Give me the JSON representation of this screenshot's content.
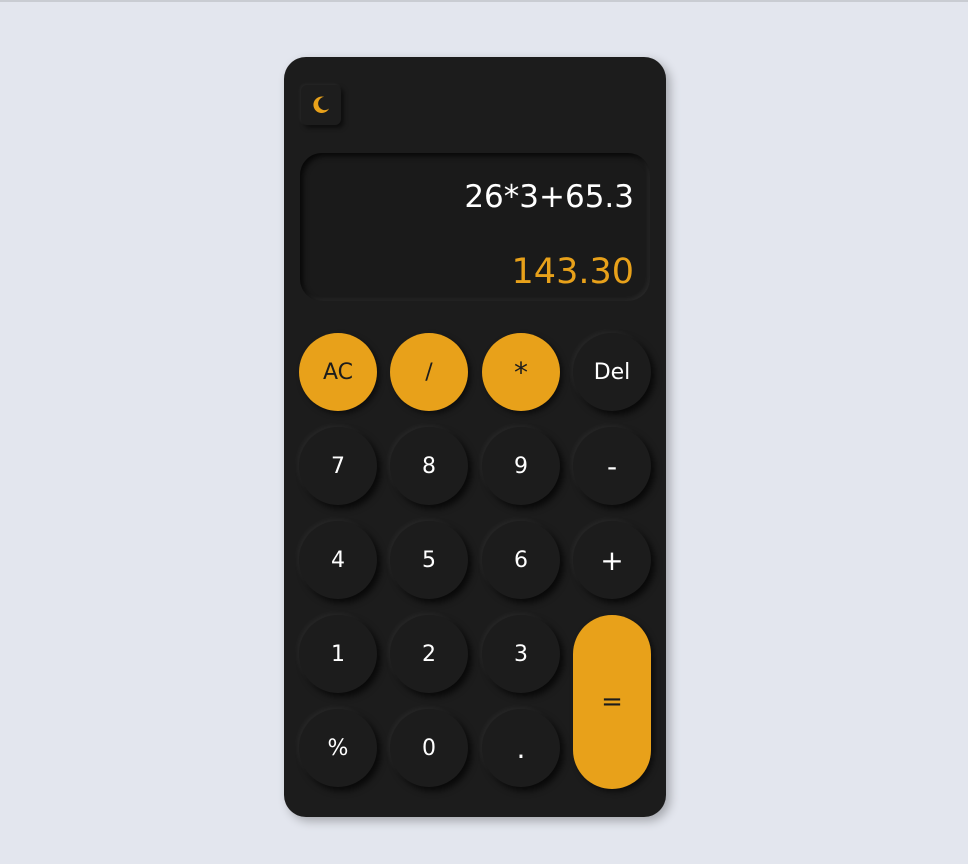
{
  "theme_toggle": {
    "icon": "moon-icon",
    "color": "#e8a11a"
  },
  "display": {
    "expression": "26*3+65.3",
    "result": "143.30"
  },
  "colors": {
    "background": "#e3e6ee",
    "panel": "#1c1c1c",
    "accent": "#e8a11a",
    "text": "#ffffff"
  },
  "keys": {
    "ac": "AC",
    "divide": "/",
    "multiply": "*",
    "del": "Del",
    "seven": "7",
    "eight": "8",
    "nine": "9",
    "minus": "-",
    "four": "4",
    "five": "5",
    "six": "6",
    "plus": "+",
    "one": "1",
    "two": "2",
    "three": "3",
    "equals": "=",
    "percent": "%",
    "zero": "0",
    "dot": "."
  }
}
